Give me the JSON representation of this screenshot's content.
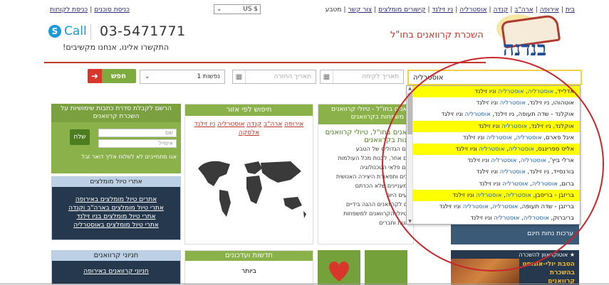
{
  "topbar": {
    "nav": [
      "בית",
      "אירופה",
      "ארה\"ב",
      "קנדה",
      "אוסטרליה",
      "ניו זילנד",
      "קישורים מומלצים",
      "צור קשר"
    ],
    "currency_label": "מטבע",
    "currency_value": "US $",
    "left_links": [
      "כניסת סוכנים",
      "כניסת לקוחות"
    ]
  },
  "header": {
    "call_label": "Call",
    "phone": "03-5471771",
    "tagline": "התקשרו אלינו, אנחנו מקשיבים!",
    "company_name": "השכרת קרוואנים בחו\"ל",
    "logo_text": "בנדנה"
  },
  "search": {
    "destination_value": "אוסטרליה",
    "pickup_placeholder": "תאריך לקיחה",
    "return_placeholder": "תאריך החזרה",
    "passengers_value": "1 נפשות",
    "button_label": "חפש"
  },
  "dropdown": {
    "accent_word": "אוסטרליה",
    "items": [
      {
        "parts": [
          "אדלייד, ",
          "אוסטרליה",
          ", ",
          "אוסטרליה",
          " וניו זילנד"
        ],
        "hl": true
      },
      {
        "parts": [
          "אוטהוהו, ניו זילנד, ",
          "אוסטרליה",
          " וניו זילנד"
        ],
        "hl": false
      },
      {
        "parts": [
          "אוקלנד - שדה תעופה, ניו זילנד, ",
          "אוסטרליה",
          " וניו זילנד"
        ],
        "hl": false
      },
      {
        "parts": [
          "אוקלנד, ניו זילנד, ",
          "אוסטרליה",
          " וניו זילנד"
        ],
        "hl": true
      },
      {
        "parts": [
          "איגל פארם, ",
          "אוסטרליה",
          ", ",
          "אוסטרליה",
          " וניו זילנד"
        ],
        "hl": false
      },
      {
        "parts": [
          "אליס ספרינגס, ",
          "אוסטרליה",
          ", ",
          "אוסטרליה",
          " וניו זילנד"
        ],
        "hl": true
      },
      {
        "parts": [
          "ארלי ביץ', ",
          "אוסטרליה",
          ", ",
          "אוסטרליה",
          " וניו זילנד"
        ],
        "hl": false
      },
      {
        "parts": [
          "בורנסייד, ניו זילנד, ",
          "אוסטרליה",
          " וניו זילנד"
        ],
        "hl": false
      },
      {
        "parts": [
          "ברום, ",
          "אוסטרליה",
          ", ",
          "אוסטרליה",
          " וניו זילנד"
        ],
        "hl": false
      },
      {
        "parts": [
          "בריזבן - בריסבן, ",
          "אוסטרליה",
          ", ",
          "אוסטרליה",
          " וניו זילנד"
        ],
        "hl": true
      },
      {
        "parts": [
          "בריזבן - שדה תעופה, ",
          "אוסטרליה",
          ", ",
          "אוסטרליה",
          " וניו זילנד"
        ],
        "hl": false
      },
      {
        "parts": [
          "בריברוק, ",
          "אוסטרליה",
          ", ",
          "אוסטרליה",
          " וניו זילנד"
        ],
        "hl": false
      }
    ]
  },
  "newsletter": {
    "title": "הרשם לקבלת סדרת כתבות שימושיות על השכרת קרוואנים",
    "name_placeholder": "שם",
    "email_placeholder": "אימייל",
    "send_label": "שלח",
    "note": "אנו מתחייבים לא לשלוח אליך דואר זבל"
  },
  "recommended": {
    "title": "אתרי טיול מומלצים",
    "links": [
      "אתרים טיול מומלצים באירופה",
      "אתרי טיול מומלצים בארה\"ב וקנדה",
      "אתרי טיול מומלצים בניו זילנד",
      "אתרי טיול מומלצים באוסטרליה"
    ]
  },
  "map_box": {
    "title": "חיפוש לפי אזור",
    "links_line1": [
      "אירופה",
      "ארה\"ב",
      "קנדה",
      "אוסטרליה",
      "ניו זילנד"
    ],
    "links_line2": "אלסקה"
  },
  "article": {
    "title": "ואנים בחו\"ל - טיולי קרוואנים\n\" משפחות בקרוואנים",
    "subtitle": "ואנים בחו\"ל, טיולי קרוואנים",
    "subtitle2": "ונות בקרוואנים",
    "lines": [
      "ים הגדולים של הטבע,",
      "ם אחר, לבנות מכל העולמות,",
      "ים פלאי הטכנולוגיה,",
      "נים ותפאורת היצירה האנושית,",
      "מעניינים שלא הכרתם,",
      "עים היום.",
      "ים לקרוואנים ההגה בידיים",
      "טיולי הקרוואנים למשפחות."
    ],
    "extra": "זוגות וחברים"
  },
  "right_panel": {
    "note": "ערכות נחות חינם"
  },
  "bottom": {
    "campers_title": "חניוני קרוואנים",
    "campers_link": "חניוני קרוואנים באירופה",
    "news_title": "חדשות ועדכונים",
    "news_text": "ביותר",
    "promo_title": "אוטוקראוון להשכרה",
    "promo_text": "הטבת יולי-אוגוסט בהשכרת קרוואנים"
  }
}
